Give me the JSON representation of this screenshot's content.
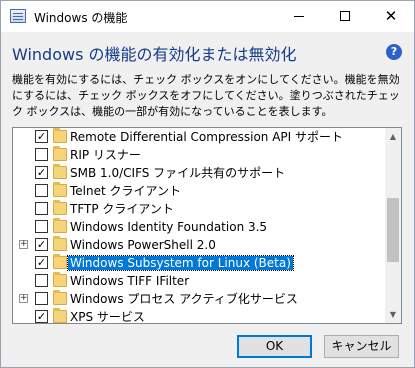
{
  "window": {
    "title": "Windows の機能",
    "minimize_glyph": "—",
    "maximize_glyph": "☐",
    "close_glyph": "✕"
  },
  "header": {
    "heading": "Windows の機能の有効化または無効化",
    "help_glyph": "?",
    "description": "機能を有効にするには、チェック ボックスをオンにしてください。機能を無効にするには、チェック ボックスをオフにしてください。塗りつぶされたチェック ボックスは、機能の一部が有効になっていることを表します。"
  },
  "features": [
    {
      "label": "Remote Differential Compression API サポート",
      "checked": true,
      "expandable": false,
      "selected": false
    },
    {
      "label": "RIP リスナー",
      "checked": false,
      "expandable": false,
      "selected": false
    },
    {
      "label": "SMB 1.0/CIFS ファイル共有のサポート",
      "checked": true,
      "expandable": false,
      "selected": false
    },
    {
      "label": "Telnet クライアント",
      "checked": false,
      "expandable": false,
      "selected": false
    },
    {
      "label": "TFTP クライアント",
      "checked": false,
      "expandable": false,
      "selected": false
    },
    {
      "label": "Windows Identity Foundation 3.5",
      "checked": false,
      "expandable": false,
      "selected": false
    },
    {
      "label": "Windows PowerShell 2.0",
      "checked": true,
      "expandable": true,
      "selected": false
    },
    {
      "label": "Windows Subsystem for Linux (Beta)",
      "checked": true,
      "expandable": false,
      "selected": true
    },
    {
      "label": "Windows TIFF IFilter",
      "checked": false,
      "expandable": false,
      "selected": false
    },
    {
      "label": "Windows プロセス アクティブ化サービス",
      "checked": false,
      "expandable": true,
      "selected": false
    },
    {
      "label": "XPS サービス",
      "checked": true,
      "expandable": false,
      "selected": false
    }
  ],
  "glyphs": {
    "check": "✓",
    "expand": "+",
    "scroll_up": "▲",
    "scroll_down": "▼"
  },
  "buttons": {
    "ok": "OK",
    "cancel": "キャンセル"
  },
  "colors": {
    "accent": "#0078d7",
    "heading": "#143c8c",
    "folder": "#f6d47a"
  }
}
